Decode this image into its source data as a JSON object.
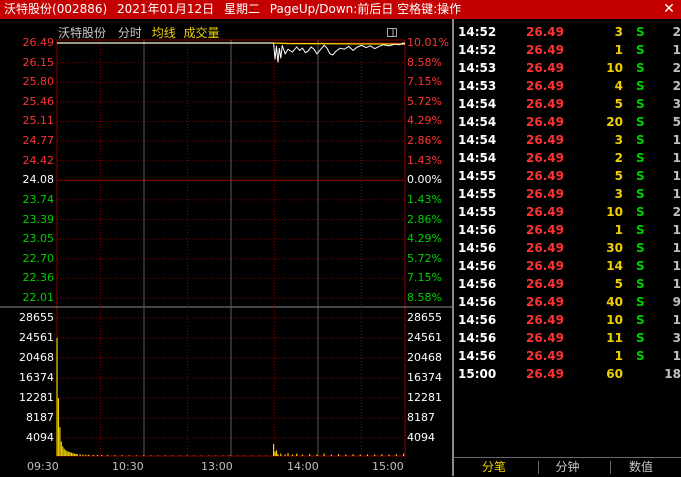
{
  "window": {
    "stock_name": "沃特股份",
    "stock_code": "(002886)",
    "date": "2021年01月12日",
    "weekday": "星期二",
    "hint": "PageUp/Down:前后日 空格键:操作",
    "close_glyph": "✕"
  },
  "chart_header": {
    "name": "沃特股份",
    "mode": "分时",
    "ma": "均线",
    "volume": "成交量"
  },
  "chart_data": {
    "type": "line",
    "prev_close": 24.08,
    "price_ticks": [
      "26.49",
      "26.15",
      "25.80",
      "25.46",
      "25.11",
      "24.77",
      "24.42",
      "24.08",
      "23.74",
      "23.39",
      "23.05",
      "22.70",
      "22.36",
      "22.01"
    ],
    "pct_ticks": [
      "10.01%",
      "8.58%",
      "7.15%",
      "5.72%",
      "4.29%",
      "2.86%",
      "1.43%",
      "0.00%",
      "1.43%",
      "2.86%",
      "4.29%",
      "5.72%",
      "7.15%",
      "8.58%"
    ],
    "volume_ticks": [
      "28655",
      "24561",
      "20468",
      "16374",
      "12281",
      "8187",
      "4094"
    ],
    "time_ticks": [
      "09:30",
      "10:30",
      "13:00",
      "14:00",
      "15:00"
    ],
    "ylim": [
      22.01,
      26.49
    ],
    "volume_max": 28655,
    "price_series": [
      [
        0,
        26.49
      ],
      [
        150,
        26.49
      ],
      [
        151,
        26.2
      ],
      [
        152,
        26.44
      ],
      [
        153,
        26.15
      ],
      [
        154,
        26.4
      ],
      [
        155,
        26.22
      ],
      [
        156,
        26.45
      ],
      [
        158,
        26.3
      ],
      [
        160,
        26.38
      ],
      [
        163,
        26.33
      ],
      [
        166,
        26.42
      ],
      [
        168,
        26.36
      ],
      [
        170,
        26.4
      ],
      [
        172,
        26.32
      ],
      [
        174,
        26.35
      ],
      [
        176,
        26.42
      ],
      [
        178,
        26.38
      ],
      [
        180,
        26.3
      ],
      [
        182,
        26.36
      ],
      [
        185,
        26.45
      ],
      [
        187,
        26.4
      ],
      [
        189,
        26.3
      ],
      [
        191,
        26.28
      ],
      [
        193,
        26.34
      ],
      [
        196,
        26.4
      ],
      [
        199,
        26.38
      ],
      [
        202,
        26.43
      ],
      [
        205,
        26.36
      ],
      [
        208,
        26.42
      ],
      [
        211,
        26.45
      ],
      [
        214,
        26.41
      ],
      [
        217,
        26.44
      ],
      [
        220,
        26.39
      ],
      [
        223,
        26.43
      ],
      [
        226,
        26.46
      ],
      [
        230,
        26.44
      ],
      [
        234,
        26.47
      ],
      [
        237,
        26.46
      ],
      [
        240,
        26.49
      ],
      [
        241,
        26.49
      ]
    ],
    "avg_series": [
      [
        0,
        26.49
      ],
      [
        150,
        26.49
      ],
      [
        160,
        26.48
      ],
      [
        241,
        26.47
      ]
    ],
    "volume_bars": [
      [
        0,
        24500
      ],
      [
        1,
        12000
      ],
      [
        2,
        6000
      ],
      [
        3,
        3000
      ],
      [
        4,
        2000
      ],
      [
        5,
        1500
      ],
      [
        6,
        1200
      ],
      [
        7,
        1000
      ],
      [
        8,
        900
      ],
      [
        9,
        800
      ],
      [
        10,
        700
      ],
      [
        11,
        600
      ],
      [
        12,
        500
      ],
      [
        13,
        450
      ],
      [
        14,
        400
      ],
      [
        16,
        350
      ],
      [
        18,
        300
      ],
      [
        20,
        280
      ],
      [
        22,
        260
      ],
      [
        25,
        240
      ],
      [
        28,
        220
      ],
      [
        31,
        200
      ],
      [
        35,
        180
      ],
      [
        40,
        160
      ],
      [
        45,
        150
      ],
      [
        50,
        140
      ],
      [
        55,
        130
      ],
      [
        60,
        120
      ],
      [
        65,
        110
      ],
      [
        70,
        100
      ],
      [
        75,
        100
      ],
      [
        80,
        100
      ],
      [
        85,
        90
      ],
      [
        90,
        90
      ],
      [
        95,
        80
      ],
      [
        100,
        80
      ],
      [
        105,
        80
      ],
      [
        110,
        70
      ],
      [
        115,
        70
      ],
      [
        119,
        70
      ],
      [
        120,
        70
      ],
      [
        125,
        70
      ],
      [
        130,
        70
      ],
      [
        135,
        70
      ],
      [
        140,
        70
      ],
      [
        145,
        70
      ],
      [
        150,
        2500
      ],
      [
        151,
        900
      ],
      [
        152,
        1200
      ],
      [
        153,
        400
      ],
      [
        155,
        500
      ],
      [
        158,
        300
      ],
      [
        160,
        600
      ],
      [
        163,
        300
      ],
      [
        166,
        500
      ],
      [
        170,
        300
      ],
      [
        175,
        400
      ],
      [
        180,
        300
      ],
      [
        185,
        500
      ],
      [
        190,
        300
      ],
      [
        195,
        400
      ],
      [
        200,
        300
      ],
      [
        205,
        350
      ],
      [
        210,
        300
      ],
      [
        215,
        350
      ],
      [
        220,
        300
      ],
      [
        225,
        350
      ],
      [
        230,
        300
      ],
      [
        235,
        350
      ],
      [
        240,
        500
      ]
    ]
  },
  "ticks": [
    {
      "time": "14:52",
      "price": "26.49",
      "vol": "3",
      "bs": "S",
      "num": "2"
    },
    {
      "time": "14:52",
      "price": "26.49",
      "vol": "1",
      "bs": "S",
      "num": "1"
    },
    {
      "time": "14:53",
      "price": "26.49",
      "vol": "10",
      "bs": "S",
      "num": "2"
    },
    {
      "time": "14:53",
      "price": "26.49",
      "vol": "4",
      "bs": "S",
      "num": "2"
    },
    {
      "time": "14:54",
      "price": "26.49",
      "vol": "5",
      "bs": "S",
      "num": "3"
    },
    {
      "time": "14:54",
      "price": "26.49",
      "vol": "20",
      "bs": "S",
      "num": "5"
    },
    {
      "time": "14:54",
      "price": "26.49",
      "vol": "3",
      "bs": "S",
      "num": "1"
    },
    {
      "time": "14:54",
      "price": "26.49",
      "vol": "2",
      "bs": "S",
      "num": "1"
    },
    {
      "time": "14:55",
      "price": "26.49",
      "vol": "5",
      "bs": "S",
      "num": "1"
    },
    {
      "time": "14:55",
      "price": "26.49",
      "vol": "3",
      "bs": "S",
      "num": "1"
    },
    {
      "time": "14:55",
      "price": "26.49",
      "vol": "10",
      "bs": "S",
      "num": "2"
    },
    {
      "time": "14:56",
      "price": "26.49",
      "vol": "1",
      "bs": "S",
      "num": "1"
    },
    {
      "time": "14:56",
      "price": "26.49",
      "vol": "30",
      "bs": "S",
      "num": "1"
    },
    {
      "time": "14:56",
      "price": "26.49",
      "vol": "14",
      "bs": "S",
      "num": "1"
    },
    {
      "time": "14:56",
      "price": "26.49",
      "vol": "5",
      "bs": "S",
      "num": "1"
    },
    {
      "time": "14:56",
      "price": "26.49",
      "vol": "40",
      "bs": "S",
      "num": "9"
    },
    {
      "time": "14:56",
      "price": "26.49",
      "vol": "10",
      "bs": "S",
      "num": "1"
    },
    {
      "time": "14:56",
      "price": "26.49",
      "vol": "11",
      "bs": "S",
      "num": "3"
    },
    {
      "time": "14:56",
      "price": "26.49",
      "vol": "1",
      "bs": "S",
      "num": "1"
    },
    {
      "time": "15:00",
      "price": "26.49",
      "vol": "60",
      "bs": "",
      "num": "18"
    }
  ],
  "tabs": [
    "分笔",
    "分钟",
    "数值"
  ],
  "colors": {
    "up": "#ff3232",
    "down": "#00d000",
    "flat": "#ffffff",
    "price_line": "#ffffff",
    "avg_line": "#f0d000",
    "grid": "#8b0000",
    "volume": "#f0d000"
  }
}
